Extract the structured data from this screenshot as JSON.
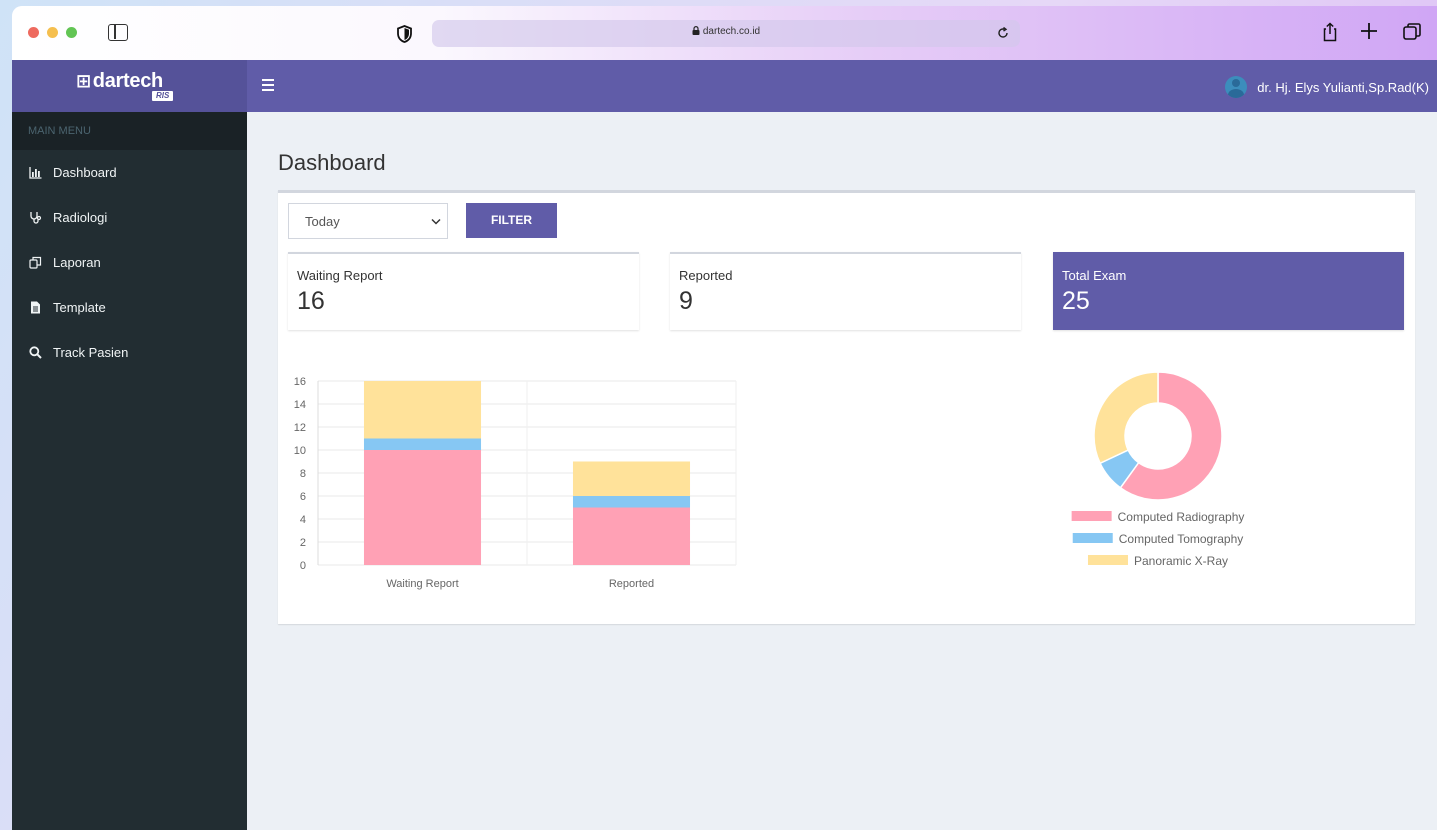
{
  "browser": {
    "url": "dartech.co.id"
  },
  "header": {
    "logo_text": "dartech",
    "logo_sub": "RIS",
    "user_name": "dr. Hj. Elys Yulianti,Sp.Rad(K)"
  },
  "sidebar": {
    "menu_header": "MAIN MENU",
    "items": [
      {
        "label": "Dashboard",
        "icon": "bar-chart-icon"
      },
      {
        "label": "Radiologi",
        "icon": "stethoscope-icon"
      },
      {
        "label": "Laporan",
        "icon": "copy-icon"
      },
      {
        "label": "Template",
        "icon": "file-icon"
      },
      {
        "label": "Track Pasien",
        "icon": "search-icon"
      }
    ]
  },
  "main": {
    "title": "Dashboard",
    "filter_period": "Today",
    "filter_label": "FILTER",
    "cards": [
      {
        "label": "Waiting Report",
        "value": "16"
      },
      {
        "label": "Reported",
        "value": "9"
      },
      {
        "label": "Total Exam",
        "value": "25"
      }
    ]
  },
  "colors": {
    "accent": "#605ca8",
    "sidebar": "#222d32",
    "series_cr": "#ffa1b5",
    "series_ct": "#86c7f3",
    "series_px": "#ffe29a"
  },
  "chart_data": [
    {
      "type": "bar",
      "stacked": true,
      "categories": [
        "Waiting Report",
        "Reported"
      ],
      "series": [
        {
          "name": "Computed Radiography",
          "values": [
            10,
            5
          ]
        },
        {
          "name": "Computed Tomography",
          "values": [
            1,
            1
          ]
        },
        {
          "name": "Panoramic X-Ray",
          "values": [
            5,
            3
          ]
        }
      ],
      "yticks": [
        "0",
        "2",
        "4",
        "6",
        "8",
        "10",
        "12",
        "14",
        "16"
      ],
      "ylim": [
        0,
        16
      ],
      "grid": true
    },
    {
      "type": "pie",
      "donut": true,
      "labels": [
        "Computed Radiography",
        "Computed Tomography",
        "Panoramic X-Ray"
      ],
      "values": [
        15,
        2,
        8
      ],
      "legend": "bottom"
    }
  ]
}
